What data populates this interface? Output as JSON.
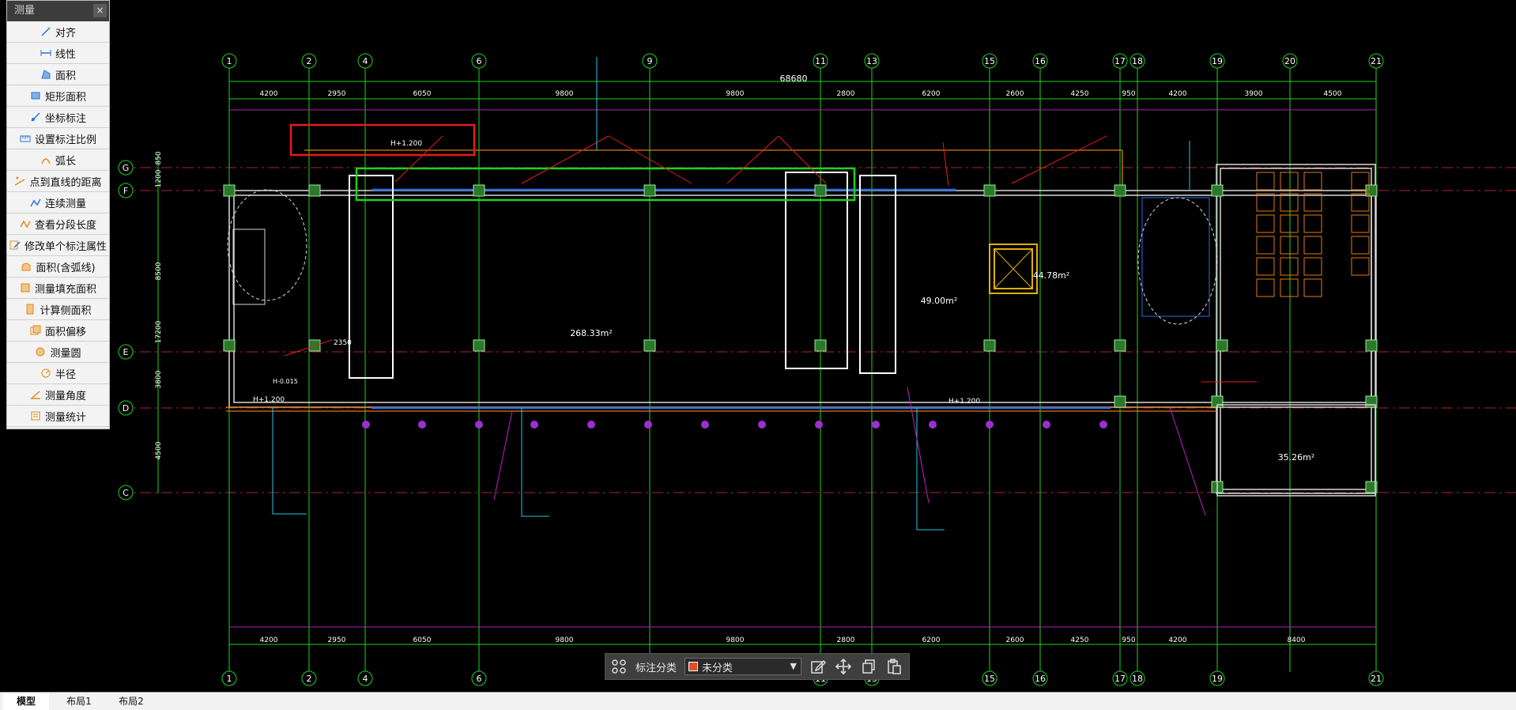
{
  "measure_panel": {
    "title": "测量",
    "close_label": "×",
    "tools": [
      {
        "label": "对齐",
        "icon": "align-dimension-icon"
      },
      {
        "label": "线性",
        "icon": "linear-dimension-icon"
      },
      {
        "label": "面积",
        "icon": "area-icon"
      },
      {
        "label": "矩形面积",
        "icon": "rectangle-area-icon"
      },
      {
        "label": "坐标标注",
        "icon": "coordinate-icon"
      },
      {
        "label": "设置标注比例",
        "icon": "scale-ratio-icon"
      },
      {
        "label": "弧长",
        "icon": "arc-length-icon"
      },
      {
        "label": "点到直线的距离",
        "icon": "point-to-line-icon"
      },
      {
        "label": "连续测量",
        "icon": "continuous-measure-icon"
      },
      {
        "label": "查看分段长度",
        "icon": "segment-length-icon"
      },
      {
        "label": "修改单个标注属性",
        "icon": "edit-annotation-icon"
      },
      {
        "label": "面积(含弧线)",
        "icon": "arc-area-icon"
      },
      {
        "label": "测量填充面积",
        "icon": "fill-area-icon"
      },
      {
        "label": "计算侧面积",
        "icon": "side-area-icon"
      },
      {
        "label": "面积偏移",
        "icon": "area-offset-icon"
      },
      {
        "label": "测量圆",
        "icon": "measure-circle-icon"
      },
      {
        "label": "半径",
        "icon": "radius-icon"
      },
      {
        "label": "测量角度",
        "icon": "angle-icon"
      },
      {
        "label": "测量统计",
        "icon": "statistics-icon"
      }
    ]
  },
  "annotation_toolbar": {
    "category_label": "标注分类",
    "selected_category": "未分类",
    "category_color": "#e14e1f"
  },
  "layout_tabs": [
    "模型",
    "布局1",
    "布局2"
  ],
  "drawing": {
    "axis_top_labels": [
      "1",
      "2",
      "4",
      "6",
      "9",
      "11",
      "13",
      "15",
      "16",
      "17",
      "18",
      "19",
      "20",
      "21"
    ],
    "axis_bottom_labels": [
      "1",
      "2",
      "4",
      "6",
      "11",
      "13",
      "15",
      "16",
      "17",
      "18",
      "19",
      "21"
    ],
    "axis_left_labels": [
      "G",
      "F",
      "E",
      "D",
      "C"
    ],
    "total_dimension": "68680",
    "top_dims": [
      "4200",
      "2950",
      "6050",
      "9800",
      "9800",
      "2800",
      "6200",
      "2600",
      "4250",
      "950",
      "4200",
      "3900",
      "4500"
    ],
    "bottom_dims": [
      "4200",
      "2950",
      "6050",
      "9800",
      "9800",
      "2800",
      "6200",
      "2600",
      "4250",
      "950",
      "4200",
      "8400"
    ],
    "left_dims": [
      "850",
      "1200",
      "8500",
      "17200",
      "3800",
      "4500"
    ],
    "rooms": [
      {
        "area": "268.33m²"
      },
      {
        "area": "49.00m²"
      },
      {
        "area": "44.78m²"
      },
      {
        "area": "35.26m²"
      }
    ],
    "level_marks": [
      "H+1.200",
      "H+1.200",
      "H+1.200",
      "H-0.015"
    ],
    "dim_2350": "2350"
  }
}
